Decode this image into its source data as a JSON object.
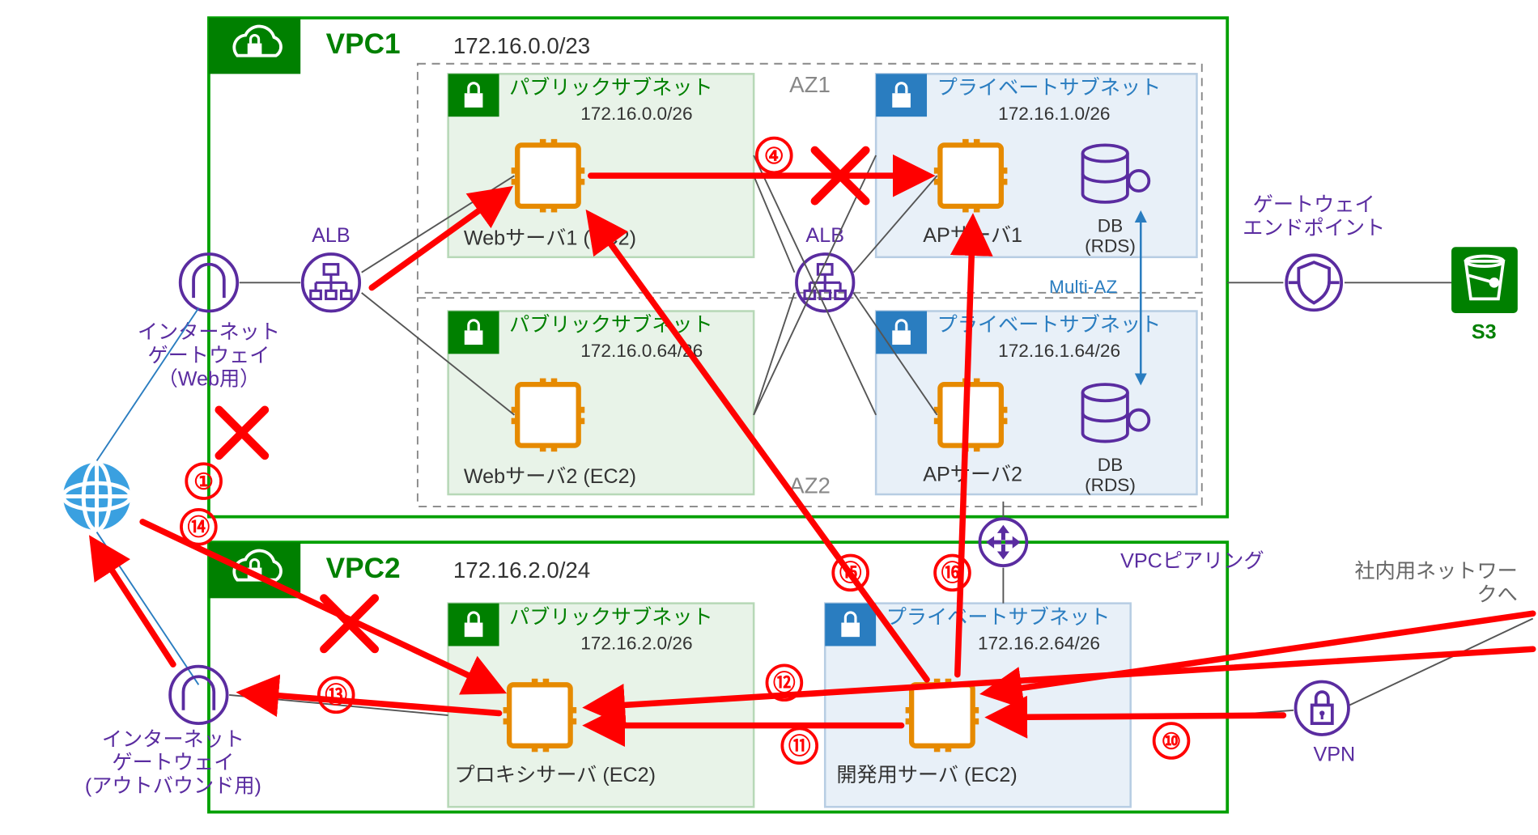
{
  "vpc1": {
    "title": "VPC1",
    "cidr": "172.16.0.0/23"
  },
  "vpc2": {
    "title": "VPC2",
    "cidr": "172.16.2.0/24"
  },
  "az1": "AZ1",
  "az2": "AZ2",
  "subnets": {
    "pub1": {
      "title": "パブリックサブネット",
      "cidr": "172.16.0.0/26"
    },
    "pub2": {
      "title": "パブリックサブネット",
      "cidr": "172.16.0.64/26"
    },
    "prv1": {
      "title": "プライベートサブネット",
      "cidr": "172.16.1.0/26"
    },
    "prv2": {
      "title": "プライベートサブネット",
      "cidr": "172.16.1.64/26"
    },
    "pub3": {
      "title": "パブリックサブネット",
      "cidr": "172.16.2.0/26"
    },
    "prv3": {
      "title": "プライベートサブネット",
      "cidr": "172.16.2.64/26"
    }
  },
  "nodes": {
    "web1": "Webサーバ1 (EC2)",
    "web2": "Webサーバ2 (EC2)",
    "ap1": "APサーバ1",
    "ap2": "APサーバ2",
    "db1a": "DB",
    "db1b": "(RDS)",
    "db2a": "DB",
    "db2b": "(RDS)",
    "proxy": "プロキシサーバ (EC2)",
    "dev": "開発用サーバ (EC2)",
    "alb1": "ALB",
    "alb2": "ALB",
    "igw1a": "インターネット",
    "igw1b": "ゲートウェイ",
    "igw1c": "（Web用）",
    "igw2a": "インターネット",
    "igw2b": "ゲートウェイ",
    "igw2c": "(アウトバウンド用)",
    "ge1": "ゲートウェイ",
    "ge2": "エンドポイント",
    "s3": "S3",
    "peering": "VPCピアリング",
    "vpn": "VPN",
    "ext1": "社内用ネットワー",
    "ext2": "クへ",
    "multiaz": "Multi-AZ"
  },
  "flow_numbers": [
    "①",
    "④",
    "⑩",
    "⑪",
    "⑫",
    "⑬",
    "⑭",
    "⑮",
    "⑯"
  ]
}
